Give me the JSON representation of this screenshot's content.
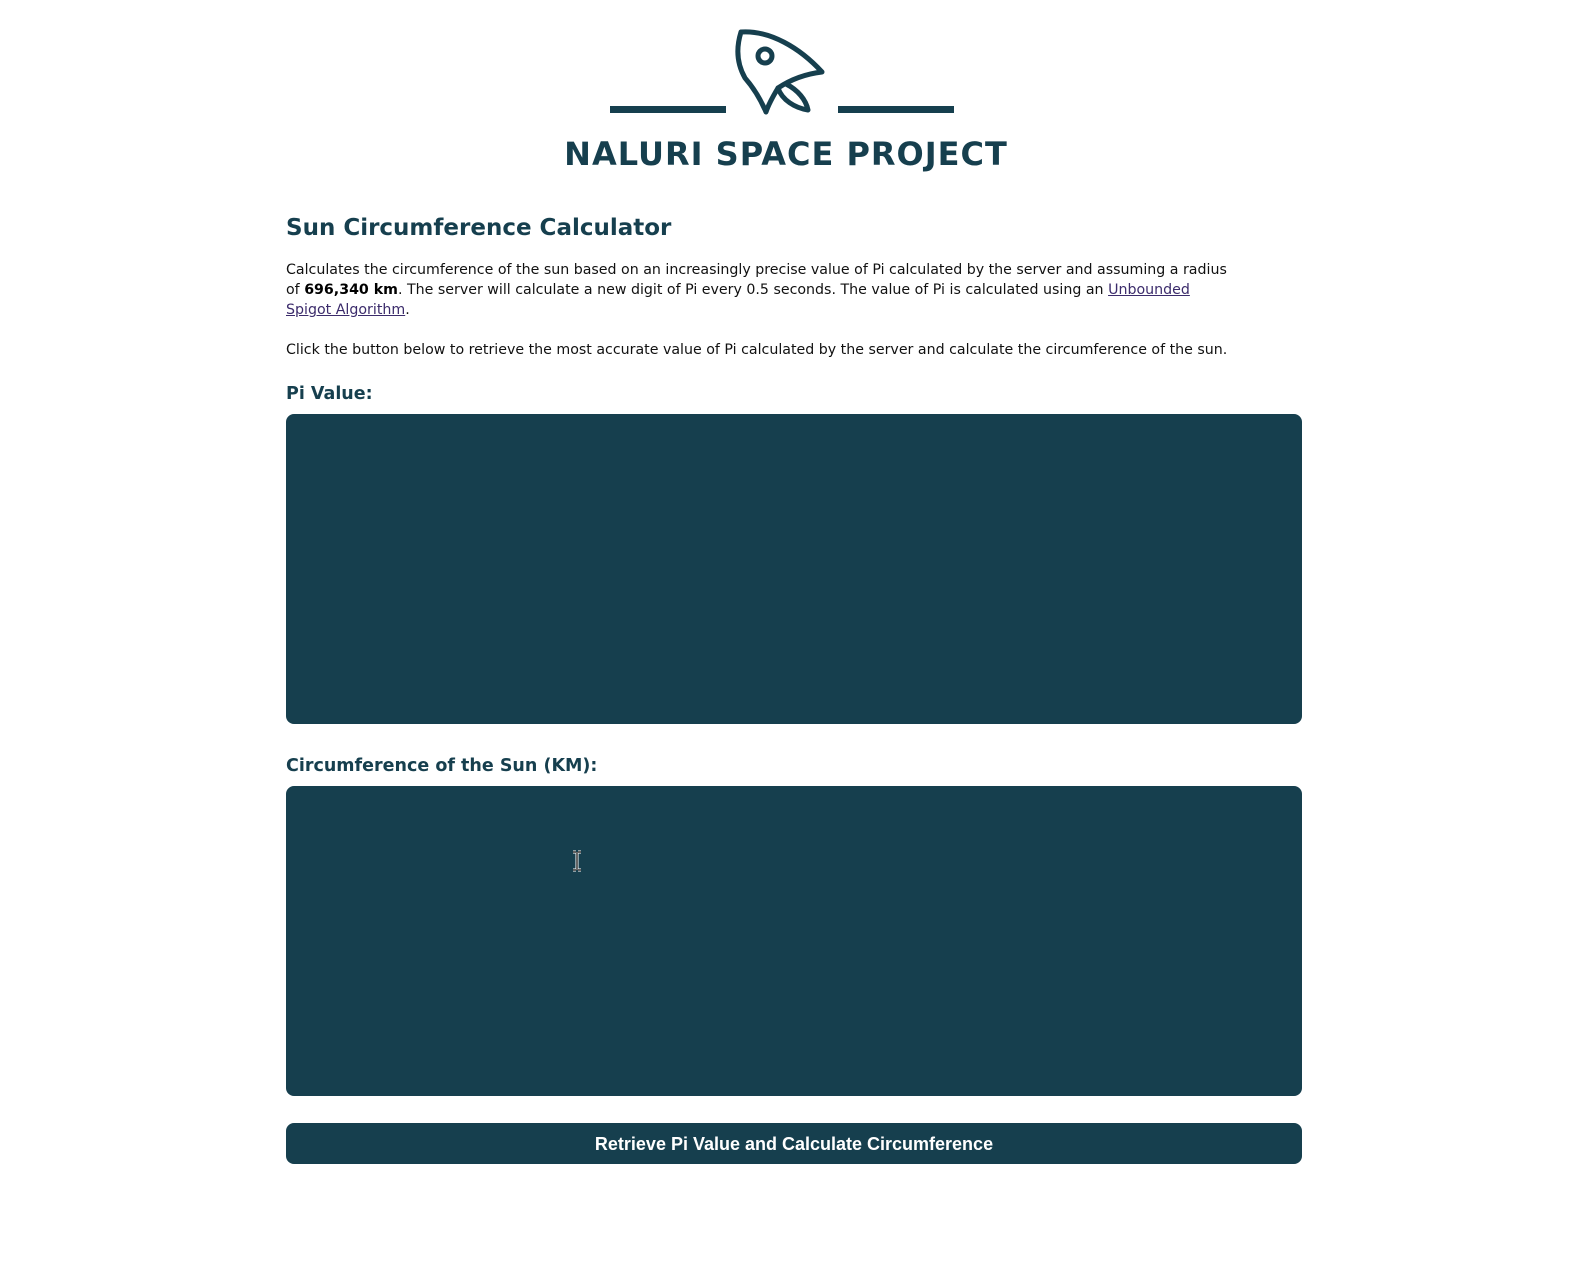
{
  "brand": {
    "title": "NALURI SPACE PROJECT",
    "logo_icon": "rocket-icon",
    "color": "#163f4e"
  },
  "page": {
    "heading": "Sun Circumference Calculator",
    "description": {
      "part1": "Calculates the circumference of the sun based on an increasingly precise value of Pi calculated by the server and assuming a radius of ",
      "radius": "696,340 km",
      "part2": ". The server will calculate a new digit of Pi every 0.5 seconds. The value of Pi is calculated using an ",
      "link_text": "Unbounded Spigot Algorithm",
      "part3": "."
    },
    "instructions": "Click the button below to retrieve the most accurate value of Pi calculated by the server and calculate the circumference of the sun."
  },
  "pi_field": {
    "label": "Pi Value:",
    "value": ""
  },
  "circumference_field": {
    "label": "Circumference of the Sun (KM):",
    "value": ""
  },
  "action": {
    "button_label": "Retrieve Pi Value and Calculate Circumference"
  },
  "colors": {
    "primary": "#163f4e",
    "link": "#3b2b6b",
    "button_text": "#ffffff"
  }
}
